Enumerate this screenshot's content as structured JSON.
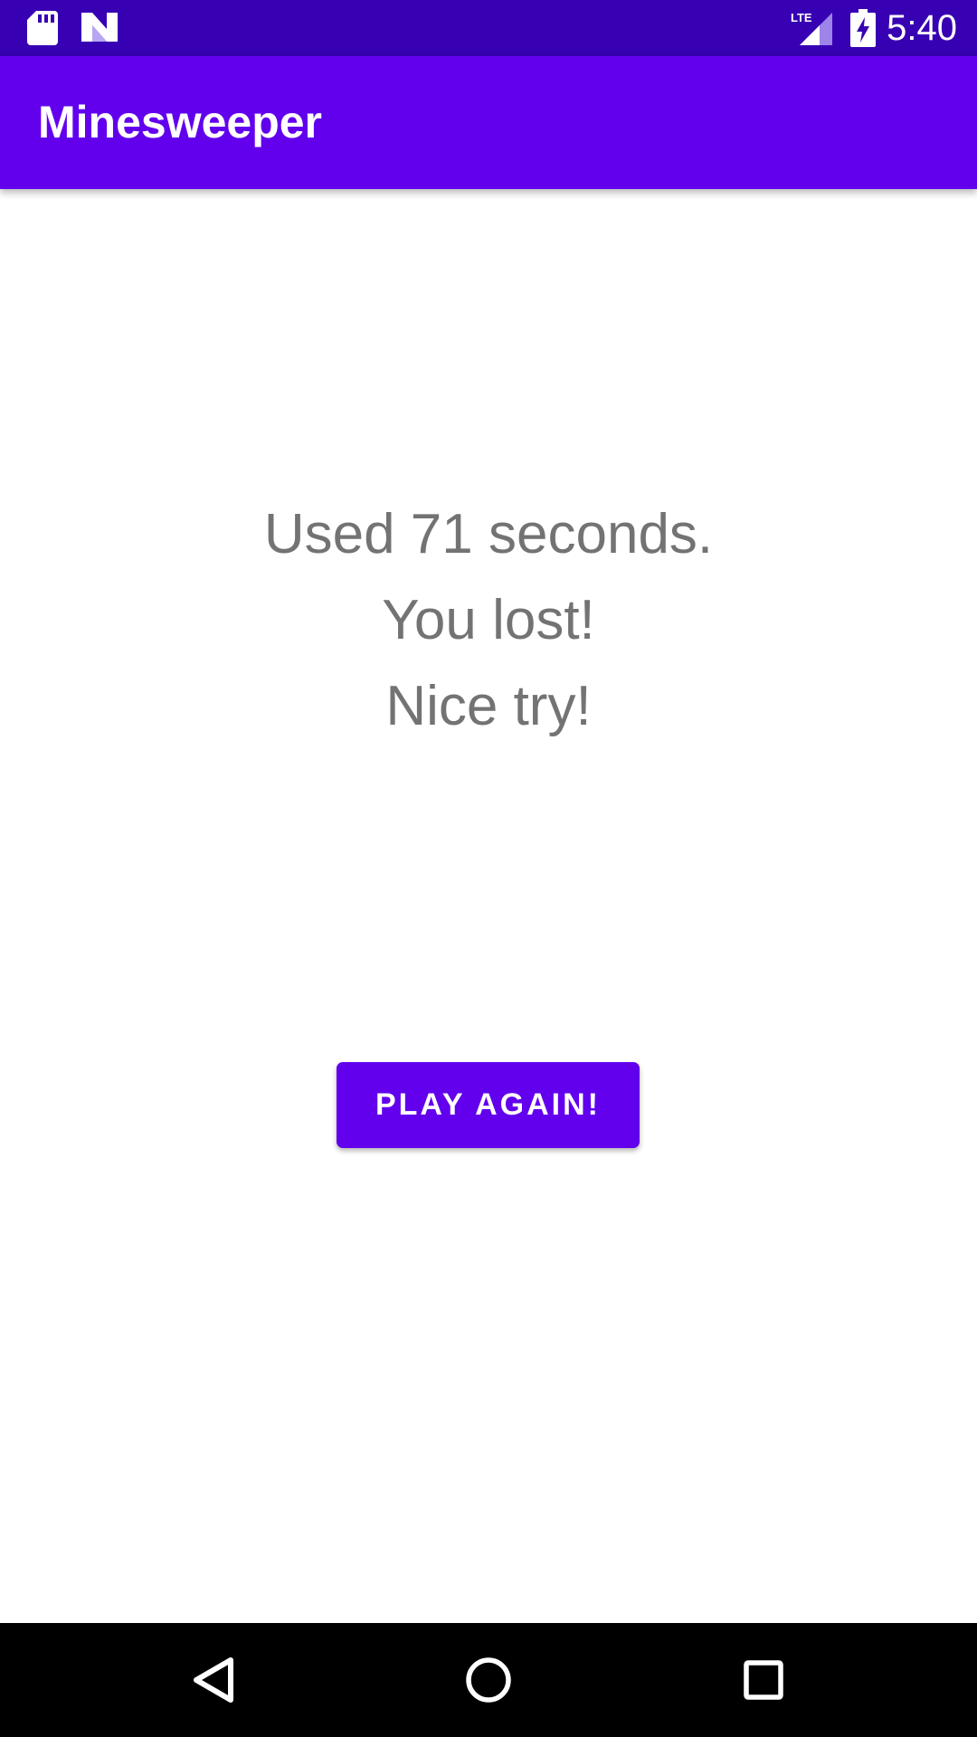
{
  "status_bar": {
    "time": "5:40",
    "network_label": "LTE",
    "icons": [
      "sd-card-icon",
      "n-notification-icon",
      "lte-signal-icon",
      "battery-charging-icon"
    ]
  },
  "app_bar": {
    "title": "Minesweeper"
  },
  "result": {
    "time_used": "Used 71 seconds.",
    "outcome": "You lost!",
    "encouragement": "Nice try!"
  },
  "actions": {
    "play_again_label": "PLAY AGAIN!"
  },
  "nav_bar": {
    "icons": [
      "back-icon",
      "home-icon",
      "recents-icon"
    ]
  },
  "colors": {
    "status_bar": "#3700B3",
    "primary": "#6200EE",
    "message_text": "#737373",
    "background": "#FFFFFF",
    "nav_bar": "#000000"
  }
}
